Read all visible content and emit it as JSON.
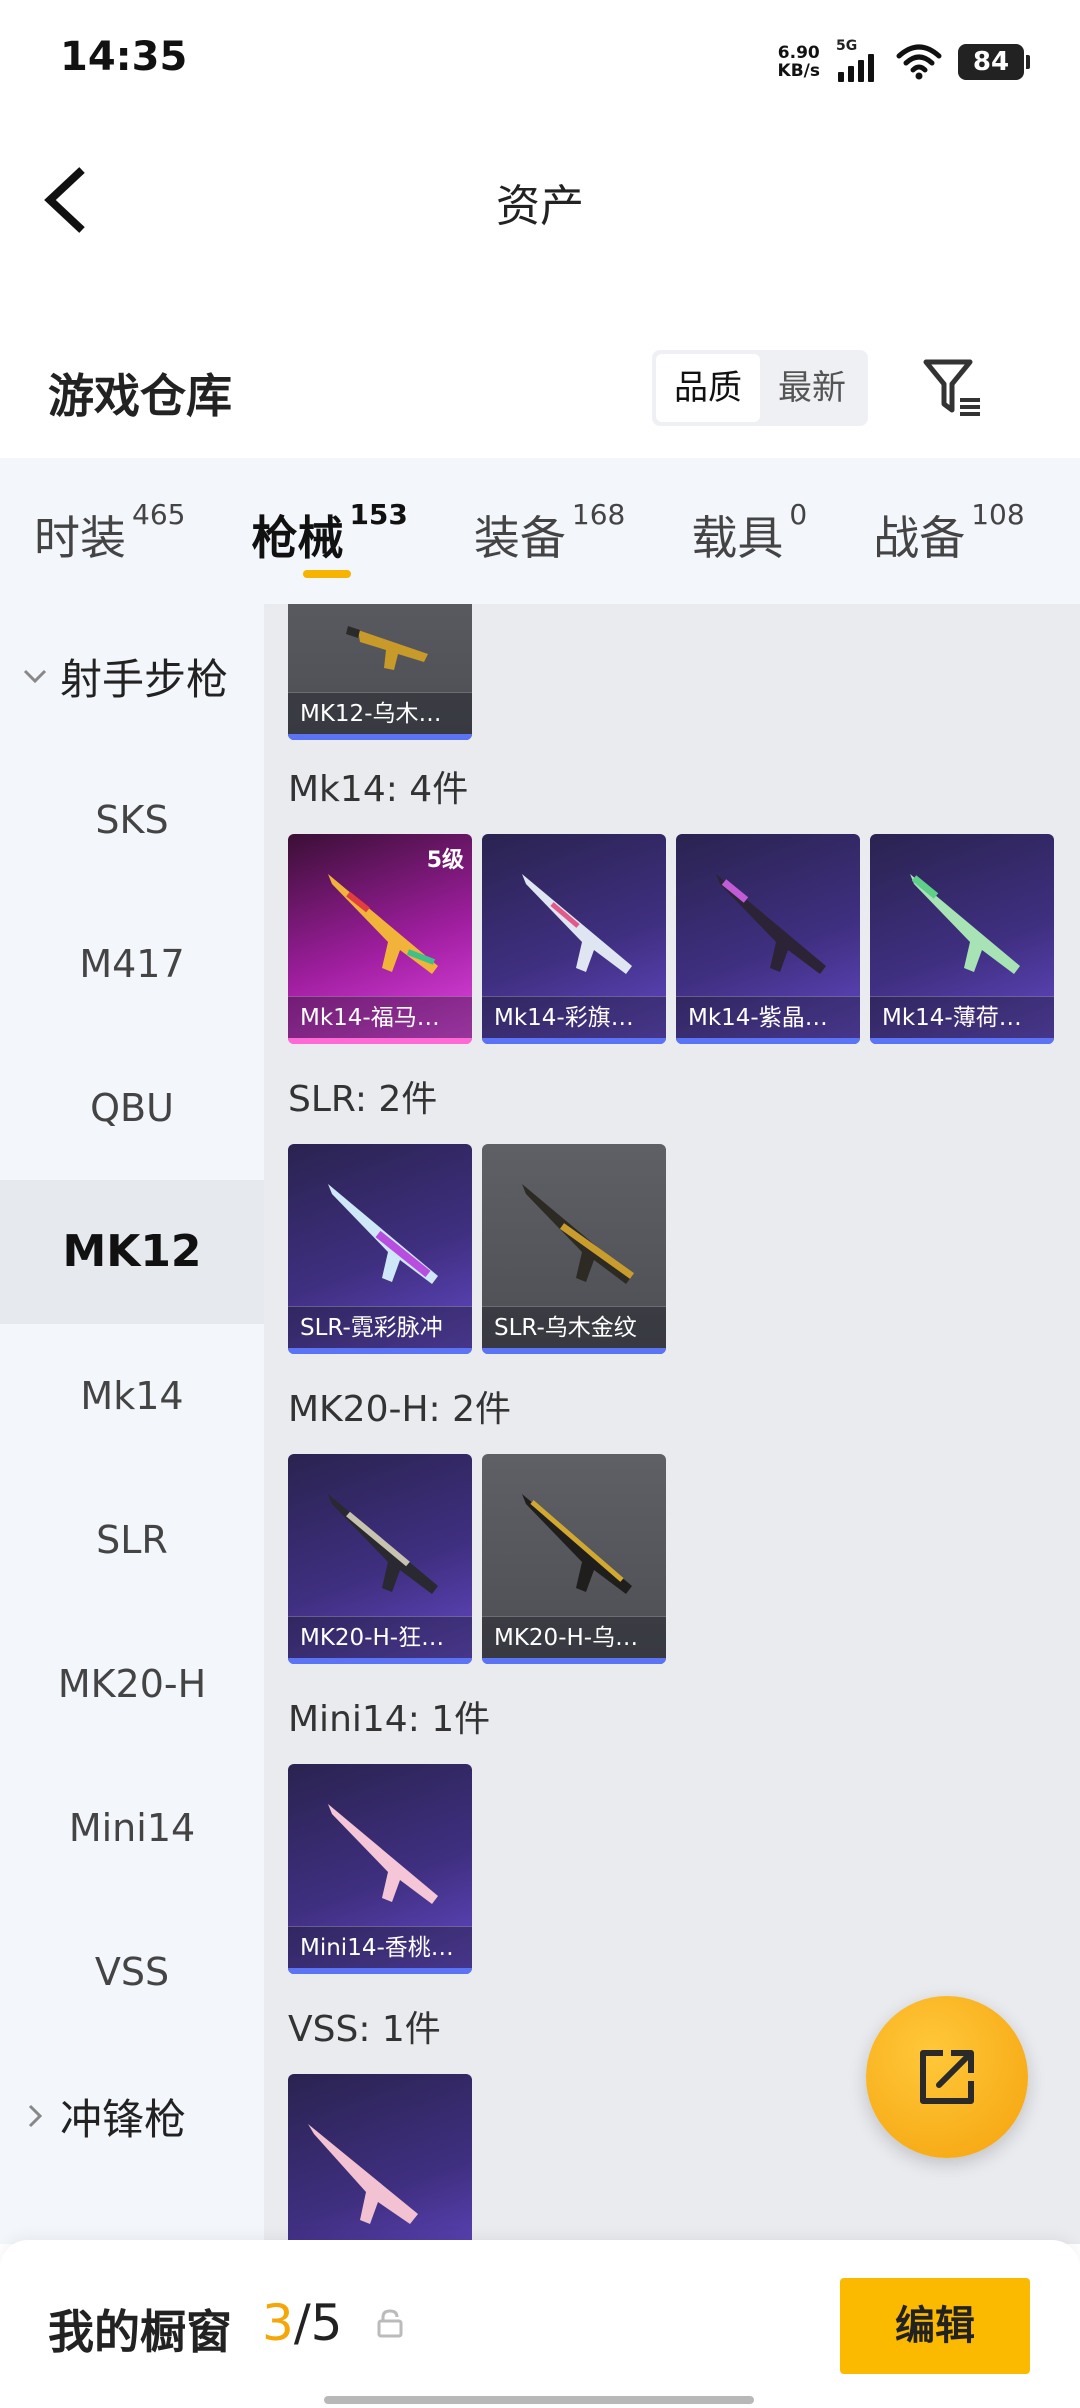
{
  "status_bar": {
    "time": "14:35",
    "net_speed_value": "6.90",
    "net_speed_unit": "KB/s",
    "signal_label": "5G",
    "battery": "84"
  },
  "header": {
    "title": "资产"
  },
  "warehouse": {
    "title": "游戏仓库",
    "sort_options": [
      "品质",
      "最新"
    ],
    "sort_selected": "品质"
  },
  "category_tabs": [
    {
      "label": "时装",
      "count": "465"
    },
    {
      "label": "枪械",
      "count": "153",
      "active": true
    },
    {
      "label": "装备",
      "count": "168"
    },
    {
      "label": "载具",
      "count": "0"
    },
    {
      "label": "战备",
      "count": "108"
    }
  ],
  "sidebar": {
    "group_expanded": "射手步枪",
    "items": [
      "SKS",
      "M417",
      "QBU",
      "MK12",
      "Mk14",
      "SLR",
      "MK20-H",
      "Mini14",
      "VSS"
    ],
    "selected": "MK12",
    "group_collapsed": "冲锋枪"
  },
  "content": {
    "top_partial_card": {
      "label": "MK12-乌木…",
      "rarity": "gray"
    },
    "sections": [
      {
        "heading": "Mk14: 4件",
        "cards": [
          {
            "label": "Mk14-福马…",
            "rarity": "pink",
            "level": "5级"
          },
          {
            "label": "Mk14-彩旗…",
            "rarity": "purple"
          },
          {
            "label": "Mk14-紫晶…",
            "rarity": "purple"
          },
          {
            "label": "Mk14-薄荷…",
            "rarity": "purple"
          }
        ]
      },
      {
        "heading": "SLR: 2件",
        "cards": [
          {
            "label": "SLR-霓彩脉冲",
            "rarity": "purple"
          },
          {
            "label": "SLR-乌木金纹",
            "rarity": "gray"
          }
        ]
      },
      {
        "heading": "MK20-H: 2件",
        "cards": [
          {
            "label": "MK20-H-狂…",
            "rarity": "purple"
          },
          {
            "label": "MK20-H-乌…",
            "rarity": "gray"
          }
        ]
      },
      {
        "heading": "Mini14: 1件",
        "cards": [
          {
            "label": "Mini14-香桃…",
            "rarity": "purple"
          }
        ]
      },
      {
        "heading": "VSS: 1件",
        "cards": [
          {
            "label": "",
            "rarity": "purple"
          }
        ]
      }
    ]
  },
  "bottom_bar": {
    "showcase_label": "我的橱窗",
    "showcase_current": "3",
    "showcase_total": "/5",
    "edit_label": "编辑"
  },
  "colors": {
    "accent": "#fbb900",
    "rarity_gray": "#55575d",
    "rarity_purple": "#4a3a9a",
    "rarity_pink": "#c02fc6"
  }
}
